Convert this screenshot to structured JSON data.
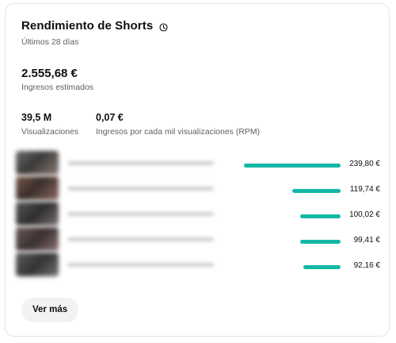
{
  "card": {
    "title": "Rendimiento de Shorts",
    "subtitle": "Últimos 28 días",
    "estimated_revenue": {
      "value": "2.555,68 €",
      "label": "Ingresos estimados"
    },
    "views": {
      "value": "39,5 M",
      "label": "Visualizaciones"
    },
    "rpm": {
      "value": "0,07 €",
      "label": "Ingresos por cada mil visualizaciones (RPM)"
    },
    "videos": [
      {
        "revenue": "239,80 €",
        "amount": 239.8
      },
      {
        "revenue": "119,74 €",
        "amount": 119.74
      },
      {
        "revenue": "100,02 €",
        "amount": 100.02
      },
      {
        "revenue": "99,41 €",
        "amount": 99.41
      },
      {
        "revenue": "92,16 €",
        "amount": 92.16
      }
    ],
    "more_button": "Ver más"
  },
  "colors": {
    "bar": "#14b8a6",
    "secondary_text": "#606060"
  },
  "icons": {
    "title_icon": "clock-icon"
  }
}
